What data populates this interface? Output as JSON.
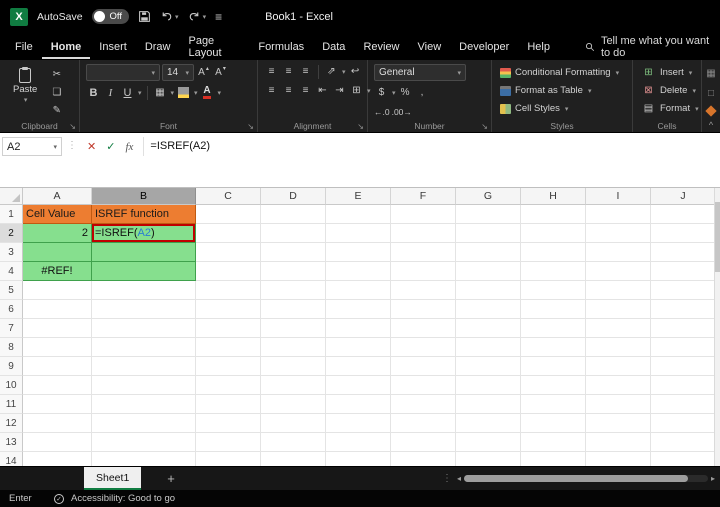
{
  "colors": {
    "excel_green": "#107C41",
    "fill_orange": "#ED7D31",
    "orange_border": "#C05A11",
    "fill_green": "#86DF8E",
    "green_border": "#3FA14C",
    "annotation_red": "#C00000",
    "ref_blue": "#2B7CD3"
  },
  "titlebar": {
    "autosave_label": "AutoSave",
    "autosave_state": "Off",
    "title": "Book1 - Excel"
  },
  "menubar": {
    "tabs": [
      "File",
      "Home",
      "Insert",
      "Draw",
      "Page Layout",
      "Formulas",
      "Data",
      "Review",
      "View",
      "Developer",
      "Help"
    ],
    "active_tab": "Home",
    "search_text": "Tell me what you want to do"
  },
  "ribbon": {
    "clipboard": {
      "label": "Clipboard",
      "paste_label": "Paste"
    },
    "font": {
      "label": "Font",
      "font_name": "",
      "font_size": "14",
      "bold": "B",
      "italic": "I",
      "underline": "U"
    },
    "alignment": {
      "label": "Alignment"
    },
    "number": {
      "label": "Number",
      "format": "General",
      "currency": "$",
      "percent": "%",
      "comma": ",",
      "increase_decimal": "←.0",
      "decrease_decimal": ".00→"
    },
    "styles": {
      "label": "Styles",
      "items": [
        "Conditional Formatting",
        "Format as Table",
        "Cell Styles"
      ]
    },
    "cells": {
      "label": "Cells",
      "items": [
        "Insert",
        "Delete",
        "Format"
      ]
    }
  },
  "formula_bar": {
    "name_box": "A2",
    "fx_label": "fx",
    "formula": "=ISREF(A2)"
  },
  "grid": {
    "columns": [
      "A",
      "B",
      "C",
      "D",
      "E",
      "F",
      "G",
      "H",
      "I",
      "J"
    ],
    "row_count": 14,
    "selected_column": "B",
    "selected_row": 2,
    "cells": [
      {
        "ref": "A1",
        "text": "Cell Value",
        "fill": "orange"
      },
      {
        "ref": "B1",
        "text": "ISREF function",
        "fill": "orange"
      },
      {
        "ref": "A2",
        "text": "2",
        "fill": "green",
        "align": "right"
      },
      {
        "ref": "B2",
        "fill": "green",
        "annotated": true,
        "formula_parts": [
          "=ISREF(",
          "A2",
          ")"
        ]
      },
      {
        "ref": "A3",
        "fill": "green"
      },
      {
        "ref": "B3",
        "fill": "green"
      },
      {
        "ref": "A4",
        "text": "#REF!",
        "fill": "green",
        "align": "center"
      },
      {
        "ref": "B4",
        "fill": "green"
      }
    ]
  },
  "sheet_tabs": {
    "active_tab": "Sheet1",
    "add_sheet_label": "+"
  },
  "status_bar": {
    "mode": "Enter",
    "accessibility_text": "Accessibility: Good to go"
  }
}
